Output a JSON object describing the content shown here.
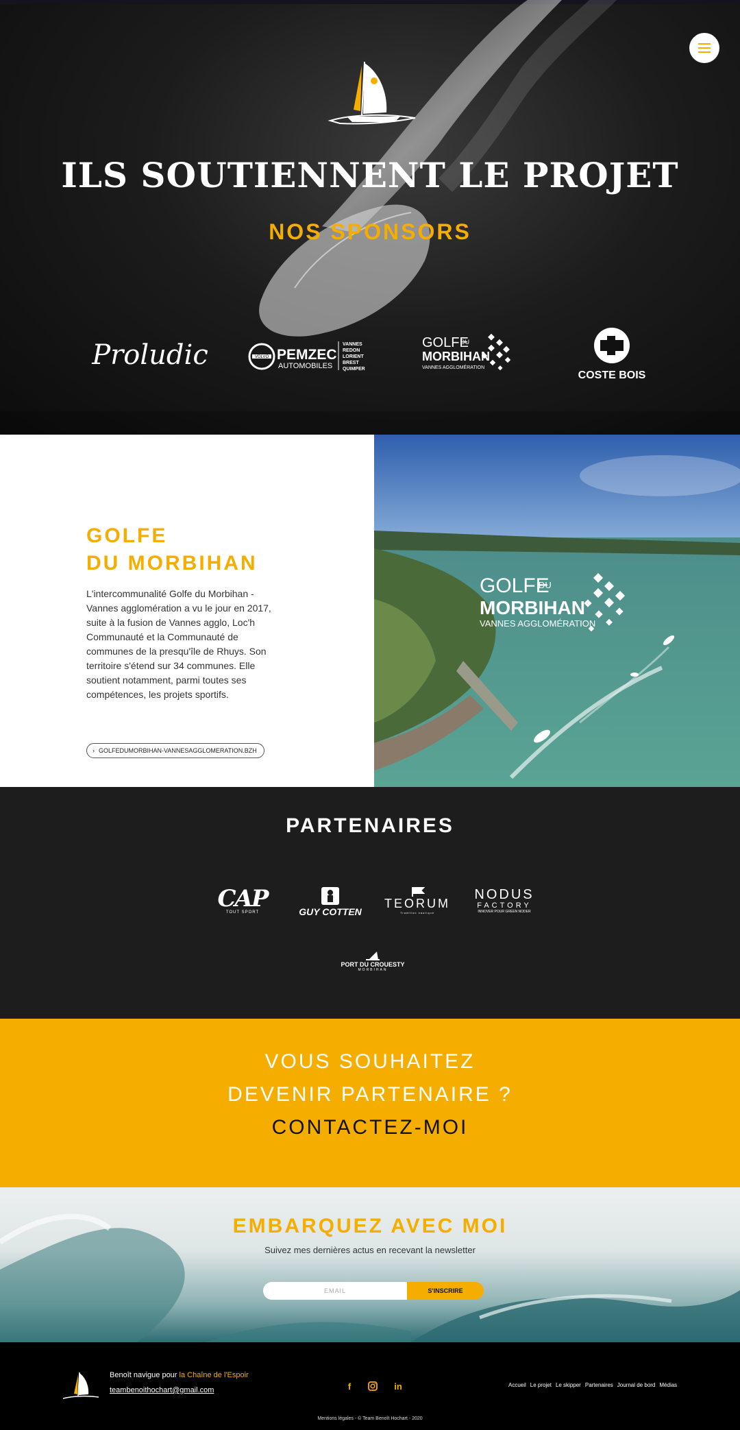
{
  "hero": {
    "title": "ILS SOUTIENNENT LE PROJET",
    "subtitle": "NOS SPONSORS",
    "sponsors": [
      {
        "name": "Proludic"
      },
      {
        "name": "PEMZEC",
        "sub": "AUTOMOBILES",
        "brand": "VOLVO",
        "cities": [
          "VANNES",
          "REDON",
          "LORIENT",
          "BREST",
          "QUIMPER"
        ]
      },
      {
        "line1": "GOLFE",
        "du": "DU",
        "line2": "MORBIHAN",
        "line3": "VANNES AGGLOMÉRATION"
      },
      {
        "name": "COSTE BOIS"
      }
    ]
  },
  "feature": {
    "title_line1": "GOLFE",
    "title_line2": "DU MORBIHAN",
    "body": "L'intercommunalité Golfe du Morbihan - Vannes agglomération a vu le jour en 2017, suite à la fusion de Vannes agglo, Loc'h Communauté et la Communauté de communes de la presqu'île de Rhuys. Son territoire s'étend sur 34 communes. Elle soutient notamment, parmi toutes ses compétences, les projets sportifs.",
    "link": "GOLFEDUMORBIHAN-VANNESAGGLOMERATION.BZH",
    "image_logo": {
      "line1": "GOLFE",
      "du": "DU",
      "line2": "MORBIHAN",
      "line3": "VANNES AGGLOMÉRATION"
    }
  },
  "partners": {
    "title": "PARTENAIRES",
    "items": [
      {
        "name": "CAP",
        "tagline": "TOUT SPORT"
      },
      {
        "name": "GUY COTTEN"
      },
      {
        "name": "TEORUM",
        "tagline": "Tradition nautique"
      },
      {
        "name": "NODUS",
        "sub": "FACTORY",
        "tagline": "INNOVER POUR GREEN NODER"
      },
      {
        "name": "PORT DU CROUESTY",
        "tagline": "MORBIHAN"
      }
    ]
  },
  "cta": {
    "line1": "VOUS SOUHAITEZ",
    "line2": "DEVENIR PARTENAIRE ?",
    "line3": "CONTACTEZ-MOI"
  },
  "newsletter": {
    "title": "EMBARQUEZ AVEC MOI",
    "subtitle": "Suivez mes dernières actus en recevant la newsletter",
    "placeholder": "EMAIL",
    "button": "S'INSCRIRE"
  },
  "footer": {
    "text": "Benoît navigue pour ",
    "highlight": "la Chaîne de l'Espoir",
    "email": "teambenoithochart@gmail.com",
    "social": [
      {
        "label": "f",
        "icon": "facebook-icon"
      },
      {
        "label": "◎",
        "icon": "instagram-icon"
      },
      {
        "label": "in",
        "icon": "linkedin-icon"
      }
    ],
    "nav": [
      "Accueil",
      "Le projet",
      "Le skipper",
      "Partenaires",
      "Journal de bord",
      "Médias"
    ],
    "legal": "Mentions légales - © Team Benoît Hochart - 2020"
  },
  "colors": {
    "accent": "#f5ae00",
    "dark": "#1d1d1d",
    "footer": "#000000"
  }
}
